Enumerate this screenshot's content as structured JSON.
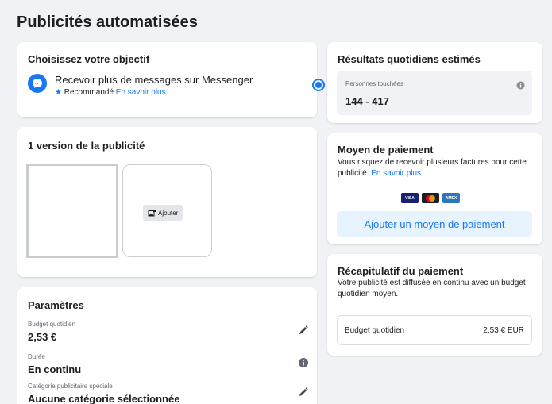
{
  "page": {
    "title": "Publicités automatisées"
  },
  "objective": {
    "title": "Choisissez votre objectif",
    "option_label": "Recevoir plus de messages sur Messenger",
    "recommended": "Recommandé",
    "learn_more": "En savoir plus",
    "icon": "messenger-icon",
    "selected": true
  },
  "version": {
    "title": "1 version de la publicité",
    "add_label": "Ajouter",
    "add_icon": "add-photo-icon"
  },
  "params": {
    "title": "Paramètres",
    "items": [
      {
        "label": "Budget quotidien",
        "value": "2,53 €",
        "icon": "edit-icon"
      },
      {
        "label": "Durée",
        "value": "En continu",
        "icon": "info-icon"
      },
      {
        "label": "Catégorie publicitaire spéciale",
        "value": "Aucune catégorie sélectionnée",
        "icon": "edit-icon"
      }
    ]
  },
  "results": {
    "title": "Résultats quotidiens estimés",
    "reach_label": "Personnes touchées",
    "reach_value": "144 - 417"
  },
  "payment": {
    "title": "Moyen de paiement",
    "description": "Vous risquez de recevoir plusieurs factures pour cette publicité.",
    "learn_more": "En savoir plus",
    "cards": [
      "VISA",
      "Mastercard",
      "AMEX"
    ],
    "add_button": "Ajouter un moyen de paiement"
  },
  "summary": {
    "title": "Récapitulatif du paiement",
    "description": "Votre publicité est diffusée en continu avec un budget quotidien moyen.",
    "row_label": "Budget quotidien",
    "row_value": "2,53 € EUR"
  },
  "colors": {
    "accent": "#1877f2",
    "background": "#f0f2f5"
  }
}
